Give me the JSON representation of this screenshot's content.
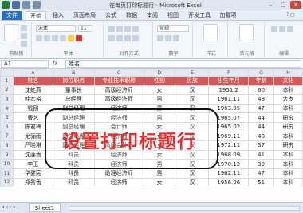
{
  "window": {
    "title": "在每页打印标题行 - Microsoft Excel"
  },
  "colors": {
    "header_row": "#d35a5a",
    "file_tab": "#2a6ebb",
    "overlay_text": "#e03030"
  },
  "tabs": [
    {
      "label": "文件"
    },
    {
      "label": "开始"
    },
    {
      "label": "插入"
    },
    {
      "label": "页面布局"
    },
    {
      "label": "公式"
    },
    {
      "label": "数据"
    },
    {
      "label": "审阅"
    },
    {
      "label": "视图"
    },
    {
      "label": "开发工具"
    },
    {
      "label": "加载项"
    }
  ],
  "ribbon": {
    "groups": [
      {
        "label": "剪贴板"
      },
      {
        "label": "字体"
      },
      {
        "label": "对齐方式"
      },
      {
        "label": "数字"
      },
      {
        "label": "样式"
      },
      {
        "label": "单元格"
      },
      {
        "label": "编辑"
      }
    ],
    "font_name": "宋体",
    "font_size": "11",
    "number_format": "常规"
  },
  "formula_bar": {
    "cell_ref": "A1",
    "fx": "fx",
    "content": "姓名"
  },
  "columns": [
    "",
    "A",
    "B",
    "C",
    "D",
    "E",
    "F",
    "G",
    "H"
  ],
  "header_row": [
    "姓名",
    "岗位职务",
    "专业技术职称",
    "性别",
    "民族",
    "出生年月",
    "年龄",
    "文化"
  ],
  "rows": [
    {
      "num": "2",
      "cells": [
        "沈虹燕",
        "董事长",
        "高级经济师",
        "女",
        "汉",
        "1951.2",
        "60",
        "本科"
      ]
    },
    {
      "num": "3",
      "cells": [
        "韩宏裕",
        "总经理",
        "高级经济师",
        "男",
        "汉",
        "1961.11",
        "48",
        "大专"
      ]
    },
    {
      "num": "4",
      "cells": [
        "钱刚",
        "副总经理",
        "经济师",
        "男",
        "汉",
        "1963.05",
        "47",
        "本科"
      ]
    },
    {
      "num": "5",
      "cells": [
        "曹艺",
        "副总经理",
        "经济师",
        "男",
        "汉",
        "1965.07",
        "44",
        "研究"
      ]
    },
    {
      "num": "6",
      "cells": [
        "陈君梅",
        "副总经理",
        "会计师",
        "女",
        "汉",
        "1965.02",
        "44",
        "研究"
      ]
    },
    {
      "num": "7",
      "cells": [
        "尤骊雨",
        "副总经理",
        "经济师",
        "女",
        "汉",
        "1969.11",
        "40",
        "本科"
      ]
    },
    {
      "num": "8",
      "cells": [
        "严晓琳",
        "副总经理",
        "高级会计师",
        "女",
        "汉",
        "1972.11",
        "37",
        "研究"
      ]
    },
    {
      "num": "9",
      "cells": [
        "沈莲香",
        "科员",
        "经济师",
        "女",
        "汉",
        "1968.09",
        "41",
        "本科"
      ]
    },
    {
      "num": "10",
      "cells": [
        "李玉",
        "科员",
        "经济师",
        "男",
        "汉",
        "1970.12",
        "39",
        "本科"
      ]
    },
    {
      "num": "11",
      "cells": [
        "华健宪",
        "科员",
        "助理经济师",
        "男",
        "汉",
        "1962.11",
        "47",
        "本科"
      ]
    },
    {
      "num": "12",
      "cells": [
        "郑秀香",
        "科员",
        "经济师",
        "女",
        "汉",
        "1956.06",
        "51",
        "本科"
      ]
    }
  ],
  "overlay": {
    "text": "设置打印标题行"
  },
  "sheet_tabs": [
    {
      "label": "Sheet1"
    }
  ]
}
